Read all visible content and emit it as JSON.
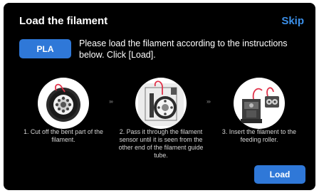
{
  "header": {
    "title": "Load the filament",
    "skip_label": "Skip"
  },
  "filament": {
    "type_label": "PLA"
  },
  "instructions": "Please load the filament according to the instructions below. Click [Load].",
  "steps": [
    {
      "image": "spool-icon",
      "caption": "1. Cut off the bent part  of the filament."
    },
    {
      "image": "sensor-tube-icon",
      "caption": "2. Pass it through the filament sensor until it is seen from the other end of the filament guide tube."
    },
    {
      "image": "extruder-roller-icon",
      "caption": "3. Insert the filament to the feeding roller."
    }
  ],
  "step_arrow": "›››",
  "actions": {
    "load_label": "Load"
  },
  "colors": {
    "background": "#000000",
    "accent": "#2f78d8",
    "link": "#3b8fe8",
    "filament": "#e0324a"
  }
}
